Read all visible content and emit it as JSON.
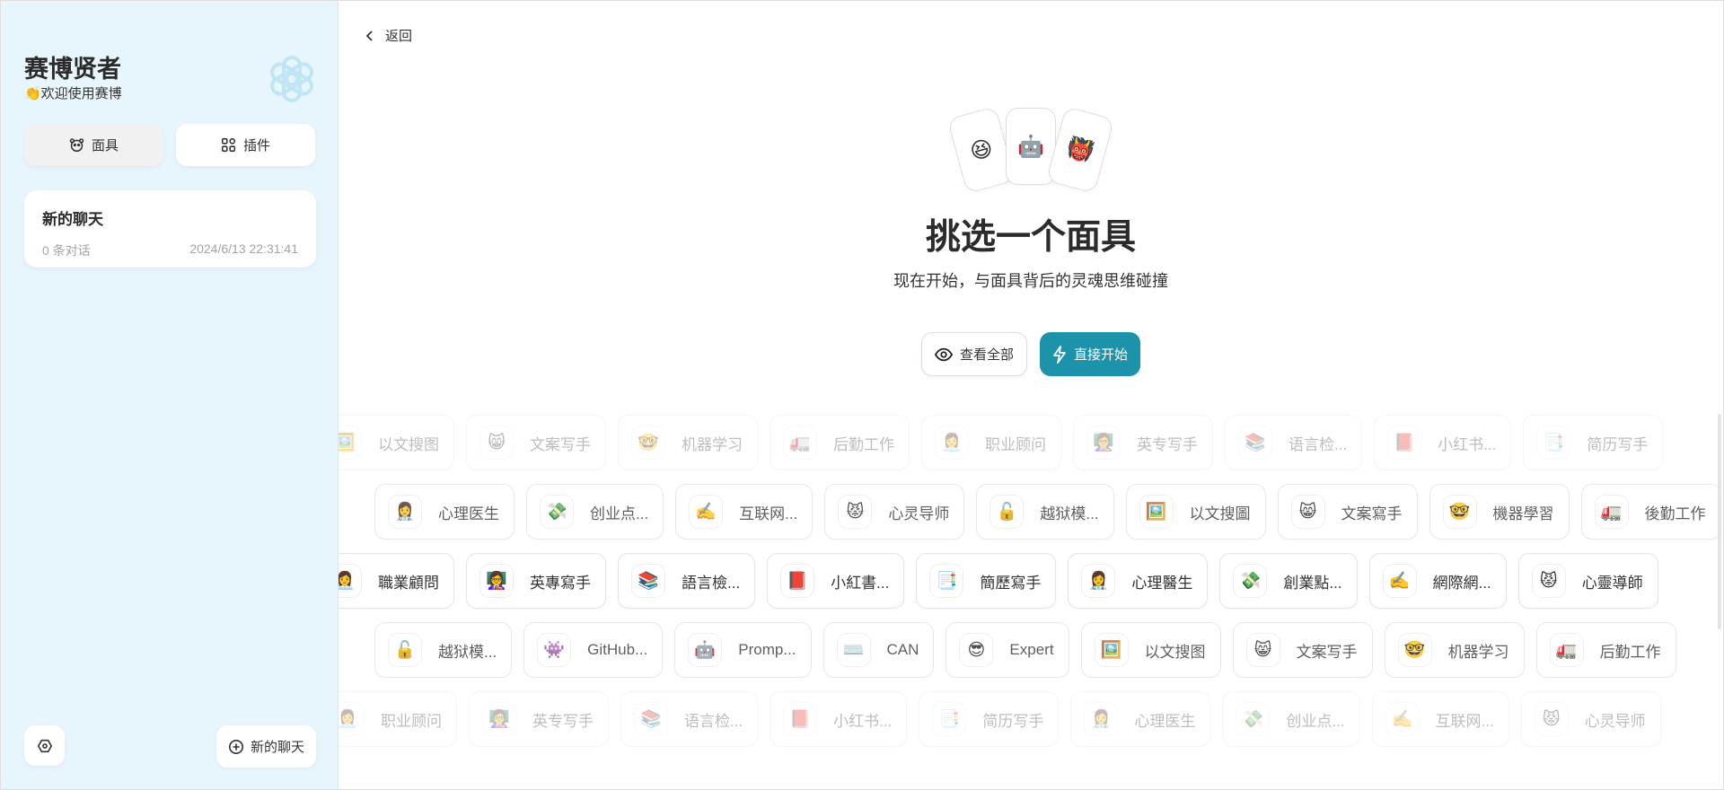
{
  "sidebar": {
    "title": "赛博贤者",
    "subtitle": "👏欢迎使用赛博",
    "logo_icon": "openai-knot-icon",
    "tabs": [
      {
        "label": "面具",
        "icon": "mask-icon",
        "active": true
      },
      {
        "label": "插件",
        "icon": "grid-icon",
        "active": false
      }
    ],
    "chats": [
      {
        "title": "新的聊天",
        "count": "0 条对话",
        "time": "2024/6/13 22:31:41"
      }
    ],
    "new_chat_label": "新的聊天"
  },
  "main": {
    "back_label": "返回",
    "cards": [
      "😆",
      "🤖",
      "👹"
    ],
    "title": "挑选一个面具",
    "subtitle": "现在开始，与面具背后的灵魂思维碰撞",
    "view_all_label": "查看全部",
    "start_label": "直接开始",
    "accent": "#1d93ab",
    "rows": [
      [
        {
          "e": "🖼️",
          "t": "以文搜图"
        },
        {
          "e": "😸",
          "t": "文案写手"
        },
        {
          "e": "🤓",
          "t": "机器学习"
        },
        {
          "e": "🚛",
          "t": "后勤工作"
        },
        {
          "e": "👩‍💼",
          "t": "职业顾问"
        },
        {
          "e": "👩‍🏫",
          "t": "英专写手"
        },
        {
          "e": "📚",
          "t": "语言检..."
        },
        {
          "e": "📕",
          "t": "小红书..."
        },
        {
          "e": "📑",
          "t": "简历写手"
        }
      ],
      [
        {
          "e": "👩‍⚕️",
          "t": "心理医生"
        },
        {
          "e": "💸",
          "t": "创业点..."
        },
        {
          "e": "✍️",
          "t": "互联网..."
        },
        {
          "e": "😾",
          "t": "心灵导师"
        },
        {
          "e": "🔓",
          "t": "越狱模..."
        },
        {
          "e": "🖼️",
          "t": "以文搜圖"
        },
        {
          "e": "😸",
          "t": "文案寫手"
        },
        {
          "e": "🤓",
          "t": "機器學習"
        },
        {
          "e": "🚛",
          "t": "後勤工作"
        }
      ],
      [
        {
          "e": "👩‍💼",
          "t": "職業顧問"
        },
        {
          "e": "👩‍🏫",
          "t": "英專寫手"
        },
        {
          "e": "📚",
          "t": "語言檢..."
        },
        {
          "e": "📕",
          "t": "小紅書..."
        },
        {
          "e": "📑",
          "t": "簡歷寫手"
        },
        {
          "e": "👩‍⚕️",
          "t": "心理醫生"
        },
        {
          "e": "💸",
          "t": "創業點..."
        },
        {
          "e": "✍️",
          "t": "網際網..."
        },
        {
          "e": "😾",
          "t": "心靈導師"
        }
      ],
      [
        {
          "e": "🔓",
          "t": "越狱模..."
        },
        {
          "e": "👾",
          "t": "GitHub..."
        },
        {
          "e": "🤖",
          "t": "Promp..."
        },
        {
          "e": "⌨️",
          "t": "CAN"
        },
        {
          "e": "😎",
          "t": "Expert"
        },
        {
          "e": "🖼️",
          "t": "以文搜图"
        },
        {
          "e": "😸",
          "t": "文案写手"
        },
        {
          "e": "🤓",
          "t": "机器学习"
        },
        {
          "e": "🚛",
          "t": "后勤工作"
        }
      ],
      [
        {
          "e": "👩‍💼",
          "t": "职业顾问"
        },
        {
          "e": "👩‍🏫",
          "t": "英专写手"
        },
        {
          "e": "📚",
          "t": "语言检..."
        },
        {
          "e": "📕",
          "t": "小红书..."
        },
        {
          "e": "📑",
          "t": "简历写手"
        },
        {
          "e": "👩‍⚕️",
          "t": "心理医生"
        },
        {
          "e": "💸",
          "t": "创业点..."
        },
        {
          "e": "✍️",
          "t": "互联网..."
        },
        {
          "e": "😾",
          "t": "心灵导师"
        }
      ]
    ]
  }
}
